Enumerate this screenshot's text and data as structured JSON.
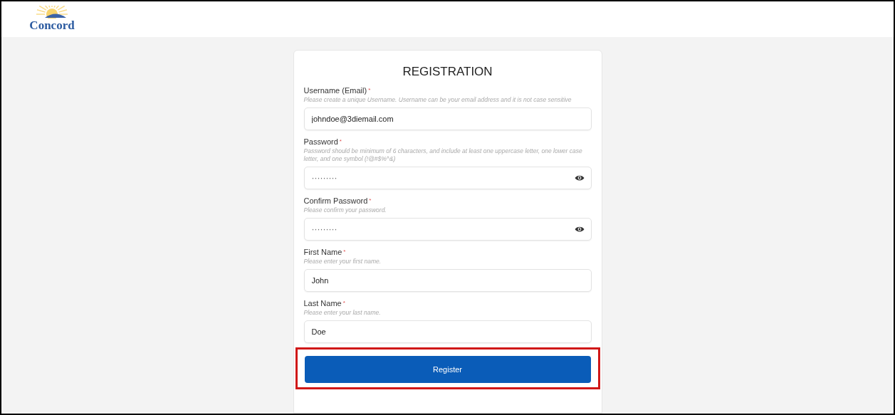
{
  "header": {
    "logo": "Concord"
  },
  "form": {
    "title": "REGISTRATION",
    "fields": [
      {
        "kind": "text",
        "label": "Username (Email)",
        "required": "*",
        "hint": "Please create a unique Username. Username can be your email address and it is not case sensitive",
        "value": "johndoe@3diemail.com"
      },
      {
        "kind": "password",
        "label": "Password",
        "required": "*",
        "hint": "Password should be minimum of 6 characters, and include at least one uppercase letter, one lower case letter, and one symbol (!@#$%^&)",
        "value": "·········"
      },
      {
        "kind": "password",
        "label": "Confirm Password",
        "required": "*",
        "hint": "Please confirm your password.",
        "value": "·········"
      },
      {
        "kind": "text",
        "label": "First Name",
        "required": "*",
        "hint": "Please enter your first name.",
        "value": "John"
      },
      {
        "kind": "text",
        "label": "Last Name",
        "required": "*",
        "hint": "Please enter your last name.",
        "value": "Doe"
      }
    ],
    "submit": {
      "label": "Register",
      "highlighted": true
    }
  }
}
